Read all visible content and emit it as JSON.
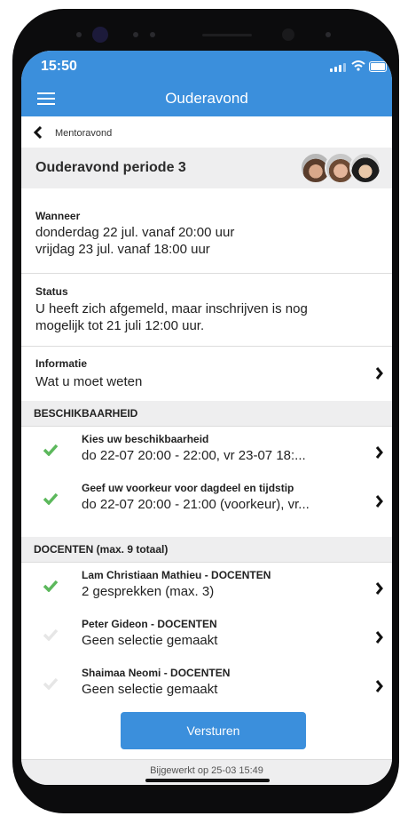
{
  "status_bar": {
    "time": "15:50"
  },
  "header": {
    "title": "Ouderavond"
  },
  "breadcrumb": {
    "label": "Mentoravond"
  },
  "event": {
    "title": "Ouderavond periode 3"
  },
  "wanneer": {
    "label": "Wanneer",
    "lines": [
      "donderdag 22 jul. vanaf 20:00 uur",
      "vrijdag 23 jul. vanaf 18:00 uur"
    ]
  },
  "status": {
    "label": "Status",
    "lines": [
      "U heeft zich afgemeld, maar inschrijven is nog",
      "mogelijk tot 21 juli 12:00 uur."
    ]
  },
  "informatie": {
    "label": "Informatie",
    "value": "Wat u moet weten"
  },
  "beschikbaarheid": {
    "header": "BESCHIKBAARHEID",
    "items": [
      {
        "title": "Kies uw beschikbaarheid",
        "sub": "do 22-07 20:00 - 22:00, vr 23-07 18:...",
        "checked": true
      },
      {
        "title": "Geef uw voorkeur voor dagdeel en tijdstip",
        "sub": "do 22-07 20:00 - 21:00 (voorkeur), vr...",
        "checked": true
      }
    ]
  },
  "docenten": {
    "header": "DOCENTEN (max. 9 totaal)",
    "items": [
      {
        "title": "Lam Christiaan Mathieu - DOCENTEN",
        "sub": "2 gesprekken (max. 3)",
        "checked": true
      },
      {
        "title": "Peter Gideon  - DOCENTEN",
        "sub": "Geen selectie gemaakt",
        "checked": false
      },
      {
        "title": "Shaimaa Neomi  - DOCENTEN",
        "sub": "Geen selectie gemaakt",
        "checked": false
      }
    ]
  },
  "submit": {
    "label": "Versturen"
  },
  "footer": {
    "text": "Bijgewerkt op 25-03 15:49"
  },
  "colors": {
    "accent": "#3b8fdc",
    "check_active": "#5cb85c",
    "check_inactive": "#e6e6e6"
  }
}
